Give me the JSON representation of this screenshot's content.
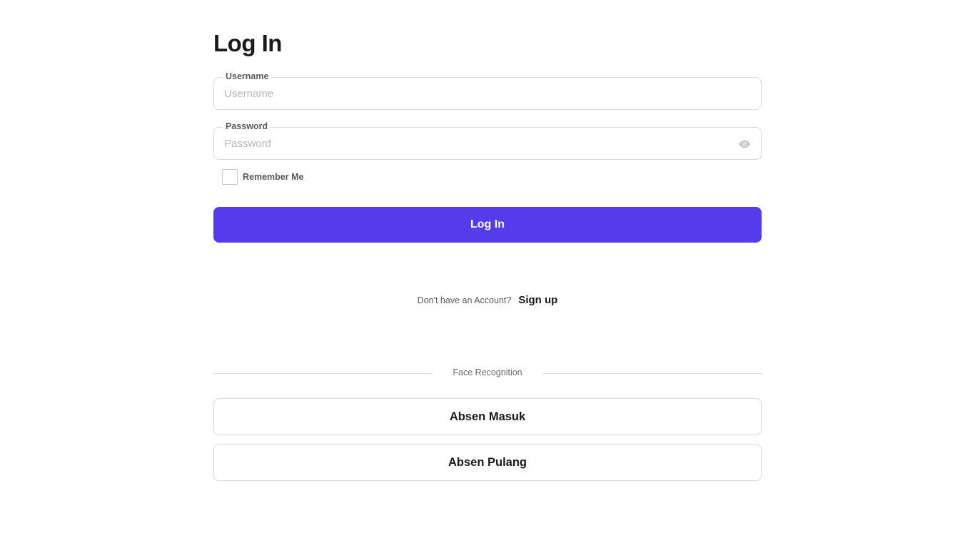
{
  "page": {
    "title": "Log In"
  },
  "form": {
    "username": {
      "label": "Username",
      "placeholder": "Username",
      "value": ""
    },
    "password": {
      "label": "Password",
      "placeholder": "Password",
      "value": "",
      "toggle_icon": "eye-icon"
    },
    "remember": {
      "label": "Remember Me",
      "checked": false
    },
    "submit_label": "Log In"
  },
  "signup": {
    "prompt": "Don't have an Account?",
    "link_label": "Sign up"
  },
  "face_recognition": {
    "divider_label": "Face Recognition",
    "buttons": [
      {
        "label": "Absen Masuk"
      },
      {
        "label": "Absen Pulang"
      }
    ]
  },
  "colors": {
    "accent": "#543ced",
    "border": "#d9d9d9",
    "muted_text": "#5a5a5a"
  }
}
